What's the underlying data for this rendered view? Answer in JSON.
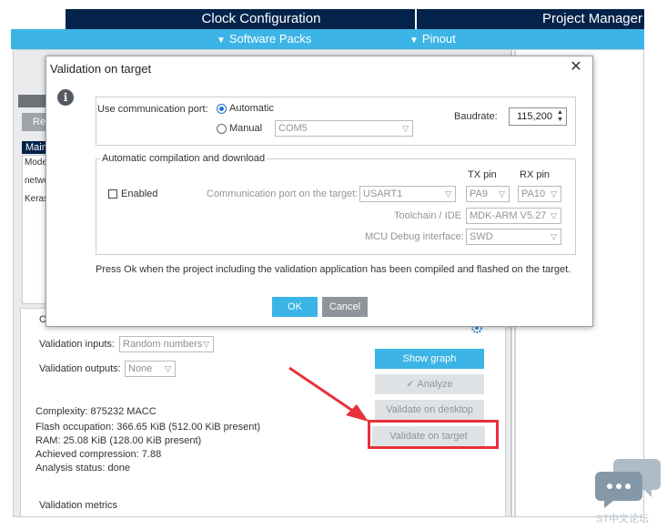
{
  "header": {
    "tab_clock": "Clock Configuration",
    "tab_project_manager": "Project Manager",
    "software_packs": "Software Packs",
    "pinout": "Pinout"
  },
  "background": {
    "reload_button": "Re",
    "main_tab": "Main",
    "model_label": "Mode",
    "model_items": [
      "netwo",
      "Keras"
    ],
    "validation_inputs_label": "Validation inputs:",
    "validation_inputs_value": "Random numbers",
    "validation_outputs_label": "Validation outputs:",
    "validation_outputs_value": "None",
    "config_label_fragment": "C",
    "stats": {
      "complexity": "Complexity:  875232 MACC",
      "flash": "Flash occupation: 366.65 KiB (512.00 KiB present)",
      "ram": "RAM: 25.08 KiB (128.00 KiB present)",
      "compression": "Achieved compression: 7.88",
      "status": "Analysis status: done"
    },
    "buttons": {
      "show_graph": "Show graph",
      "analyze": "Analyze",
      "validate_desktop": "Validate on desktop",
      "validate_target": "Validate on target"
    },
    "validation_metrics": "Validation metrics"
  },
  "dialog": {
    "title": "Validation on target",
    "close_glyph": "✕",
    "info_glyph": "i",
    "comm_port_label": "Use communication port:",
    "automatic_label": "Automatic",
    "manual_label": "Manual",
    "manual_port_value": "COM5",
    "baudrate_label": "Baudrate:",
    "baudrate_value": "115,200",
    "auto_group_title": "Automatic compilation and download",
    "enabled_label": "Enabled",
    "tx_pin_header": "TX pin",
    "rx_pin_header": "RX pin",
    "comm_port_target_label": "Communication port on the target:",
    "comm_port_target_value": "USART1",
    "tx_pin_value": "PA9",
    "rx_pin_value": "PA10",
    "toolchain_label": "Toolchain / IDE",
    "toolchain_value": "MDK-ARM V5.27",
    "debug_label": "MCU Debug interface:",
    "debug_value": "SWD",
    "message": "Press Ok when the project including the validation application has been compiled and flashed on the target.",
    "ok_label": "OK",
    "cancel_label": "Cancel"
  },
  "watermark": {
    "text": "ST中文论坛"
  },
  "colors": {
    "header_dark": "#03234b",
    "accent_blue": "#3cb4e6",
    "highlight_red": "#e8313a"
  }
}
